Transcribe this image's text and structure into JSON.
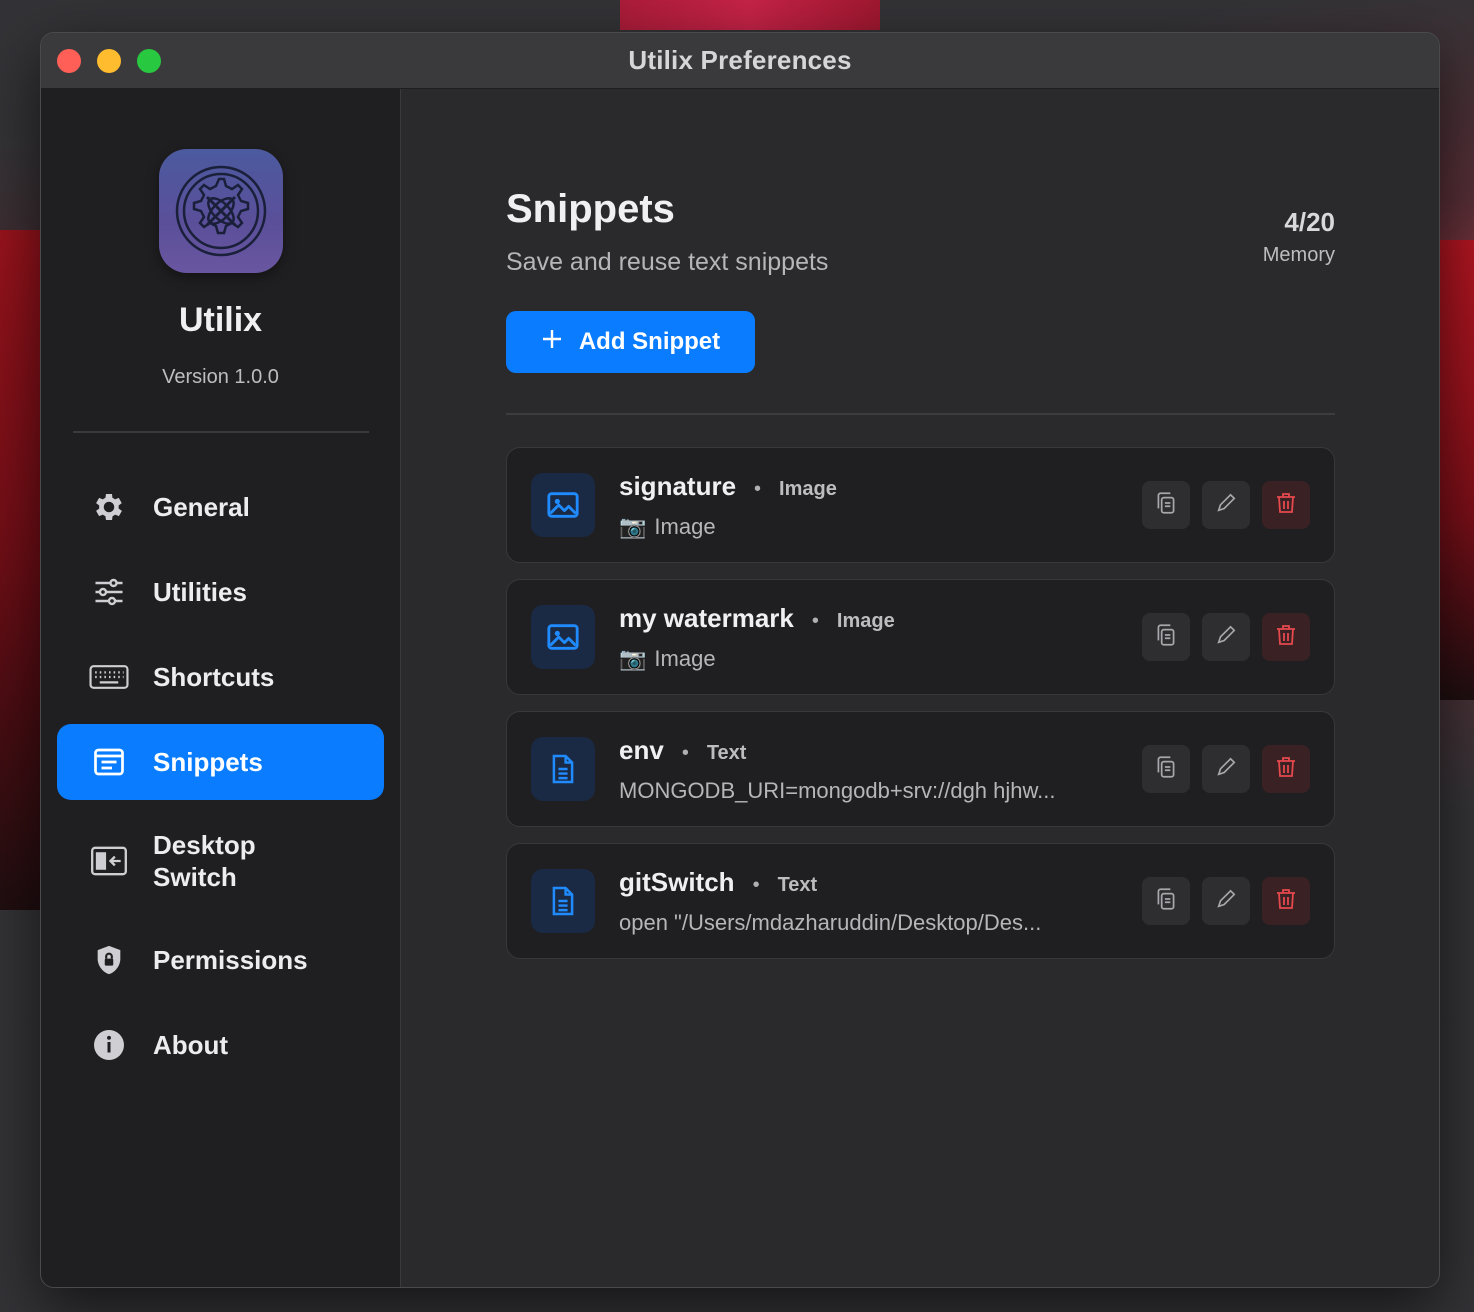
{
  "window": {
    "title": "Utilix Preferences"
  },
  "sidebar": {
    "app_name": "Utilix",
    "version": "Version 1.0.0",
    "items": [
      {
        "label": "General",
        "icon": "gear-icon"
      },
      {
        "label": "Utilities",
        "icon": "sliders-icon"
      },
      {
        "label": "Shortcuts",
        "icon": "keyboard-icon"
      },
      {
        "label": "Snippets",
        "icon": "snippet-icon",
        "active": true
      },
      {
        "label": "Desktop Switch",
        "icon": "desktop-switch-icon"
      },
      {
        "label": "Permissions",
        "icon": "shield-icon"
      },
      {
        "label": "About",
        "icon": "info-icon"
      }
    ]
  },
  "main": {
    "title": "Snippets",
    "subtitle": "Save and reuse text snippets",
    "memory": {
      "count": "4/20",
      "label": "Memory"
    },
    "add_button": "Add Snippet",
    "snippets": [
      {
        "name": "signature",
        "type": "Image",
        "preview": "Image",
        "kind": "image"
      },
      {
        "name": "my watermark",
        "type": "Image",
        "preview": "Image",
        "kind": "image"
      },
      {
        "name": "env",
        "type": "Text",
        "preview": "MONGODB_URI=mongodb+srv://dgh hjhw...",
        "kind": "text"
      },
      {
        "name": "gitSwitch",
        "type": "Text",
        "preview": "open \"/Users/mdazharuddin/Desktop/Des...",
        "kind": "text"
      }
    ]
  },
  "colors": {
    "accent": "#0a7cff",
    "danger": "#e5484d",
    "sidebar_bg": "#1f1f21",
    "main_bg": "#2a2a2c"
  }
}
